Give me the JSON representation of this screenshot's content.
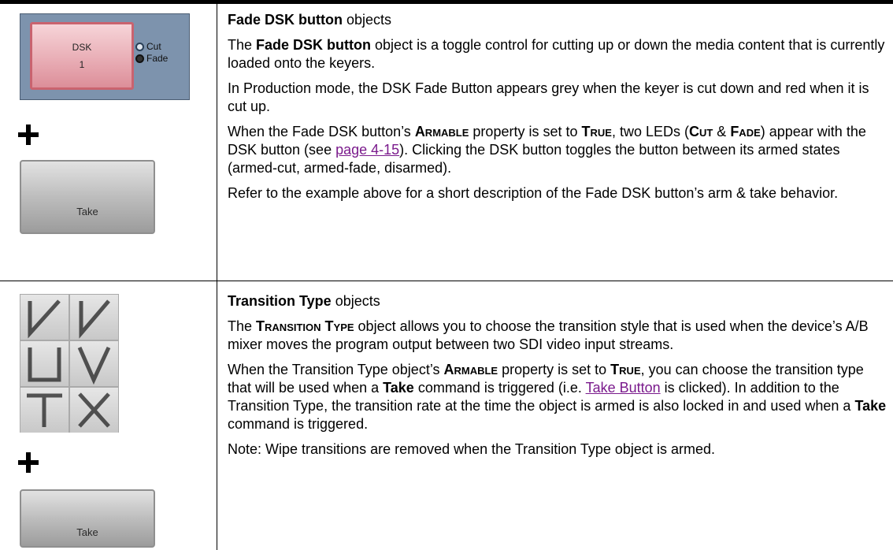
{
  "row1": {
    "heading_bold": "Fade DSK button",
    "heading_rest": " objects",
    "p1_a": "The ",
    "p1_bold": "Fade DSK button",
    "p1_b": " object is a toggle control for cutting up or down the media content that is currently loaded onto the keyers.",
    "p2": "In Production mode, the DSK Fade Button appears grey when the keyer is cut down and red when it is cut up.",
    "p3_a": "When the Fade DSK button’s ",
    "p3_armable": "Armable",
    "p3_b": " property is set to ",
    "p3_true": "True",
    "p3_c": ", two LEDs (",
    "p3_cut": "Cut",
    "p3_d": " & ",
    "p3_fade": "Fade",
    "p3_e": ") appear with the DSK button (see ",
    "p3_link": "page 4-15",
    "p3_f": "). Clicking the DSK button toggles the button between its armed states (armed-cut, armed-fade, disarmed).",
    "p4": "Refer to the example above for a short description of the Fade DSK button’s arm & take behavior.",
    "dsk_label": "DSK",
    "dsk_number": "1",
    "led_cut": "Cut",
    "led_fade": "Fade",
    "take_label": "Take"
  },
  "row2": {
    "heading_bold": "Transition Type",
    "heading_rest": " objects",
    "p1_a": "The ",
    "p1_sc": "Transition Type",
    "p1_b": " object allows you to choose the transition style that is used when the device’s A/B mixer moves the program output between two SDI video input streams.",
    "p2_a": "When the Transition Type object’s ",
    "p2_armable": "Armable",
    "p2_b": " property is set to ",
    "p2_true": "True",
    "p2_c": ", you can choose the transition type that will be used when a ",
    "p2_take1": "Take",
    "p2_d": " command is triggered (i.e. ",
    "p2_link": "Take Button",
    "p2_e": " is clicked). In addition to the Transition Type, the transition rate at the time the object is armed is also locked in and used when a ",
    "p2_take2": "Take",
    "p2_f": " command is triggered.",
    "p3": "Note: Wipe transitions are removed when the Transition Type object is armed.",
    "take_label": "Take",
    "tiles": [
      "wipe-left-icon",
      "wipe-right-icon",
      "v-wipe-icon",
      "v-wipe-alt-icon",
      "t-wipe-icon",
      "x-wipe-icon"
    ]
  }
}
